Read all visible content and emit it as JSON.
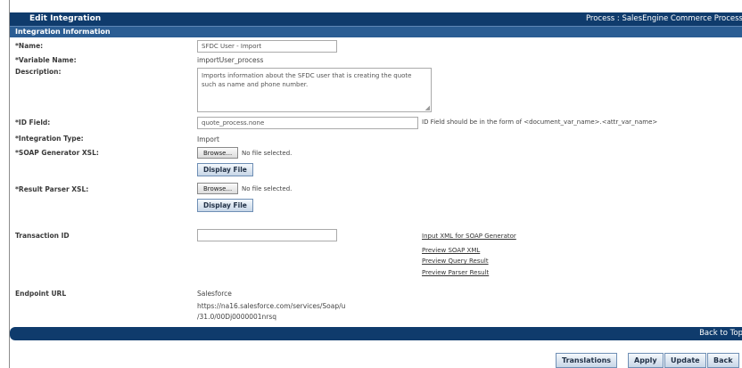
{
  "header": {
    "title": "Edit Integration",
    "process": "Process : SalesEngine Commerce Process"
  },
  "section": {
    "title": "Integration Information"
  },
  "fields": {
    "name": {
      "label": "*Name:",
      "value": "SFDC User - Import"
    },
    "variable_name": {
      "label": "*Variable Name:",
      "value": "importUser_process"
    },
    "description": {
      "label": "Description:",
      "value": "Imports information about the SFDC user that is creating the quote such as name and phone number."
    },
    "id_field": {
      "label": "*ID Field:",
      "value": "quote_process.none",
      "hint": "ID Field should be in the form of <document_var_name>.<attr_var_name>"
    },
    "integration_type": {
      "label": "*Integration Type:",
      "value": "Import"
    },
    "soap_generator": {
      "label": "*SOAP Generator XSL:",
      "browse": "Browse...",
      "no_file": "No file selected.",
      "display": "Display File"
    },
    "result_parser": {
      "label": "*Result Parser XSL:",
      "browse": "Browse...",
      "no_file": "No file selected.",
      "display": "Display File"
    },
    "transaction_id": {
      "label": "Transaction ID",
      "value": ""
    },
    "endpoint": {
      "label": "Endpoint URL",
      "type": "Salesforce",
      "url_line1": "https://na16.salesforce.com/services/Soap/u",
      "url_line2": "/31.0/00Dj0000001nrsq"
    }
  },
  "links": {
    "input_xml": "Input XML for SOAP Generator",
    "preview_soap": "Preview SOAP XML",
    "preview_query": "Preview Query Result",
    "preview_parser": "Preview Parser Result"
  },
  "footer": {
    "back_to_top": "Back to Top"
  },
  "actions": {
    "translations": "Translations",
    "apply": "Apply",
    "update": "Update",
    "back": "Back"
  },
  "colors": {
    "header": "#0f3b6c",
    "section": "#2b5d93"
  }
}
